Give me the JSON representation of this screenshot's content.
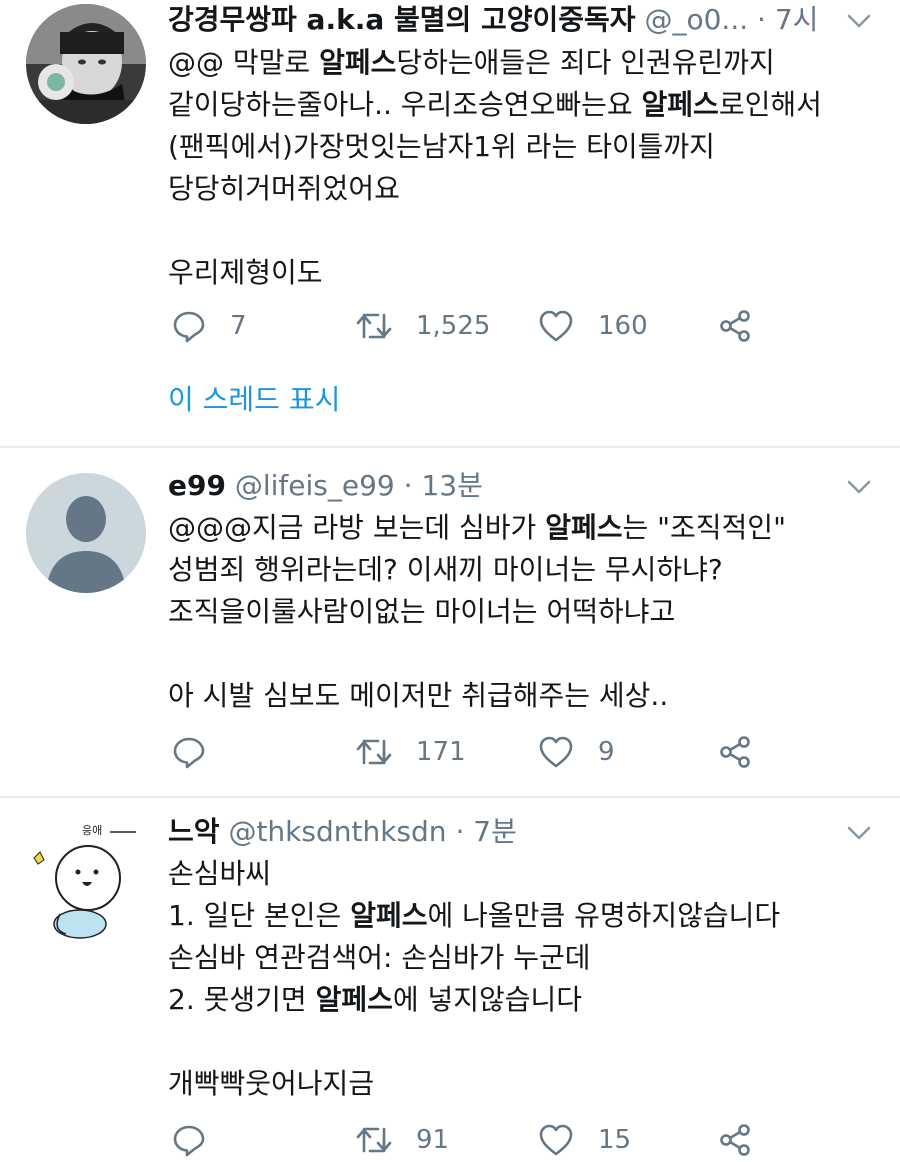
{
  "tweets": [
    {
      "name": "강경무쌍파 a.k.a 불멸의 고양이중독자",
      "handle": "@_o0...",
      "dot": "·",
      "time": "7시",
      "body": [
        "@@ 막말로 |알페스|당하는애들은 죄다 인권유린까지",
        "같이당하는줄아나.. 우리조승연오빠는요 |알페스|로인해서",
        "(팬픽에서)가장멋잇는남자1위 라는 타이틀까지",
        "당당히거머쥐었어요",
        "",
        "우리제형이도"
      ],
      "reply_count": "7",
      "retweet_count": "1,525",
      "like_count": "160",
      "show_thread": "이 스레드 표시"
    },
    {
      "name": "e99",
      "handle": "@lifeis_e99",
      "dot": "·",
      "time": "13분",
      "body": [
        "@@@지금 라방 보는데 심바가 |알페스|는 \"조직적인\"",
        "성범죄 행위라는데? 이새끼 마이너는 무시하냐?",
        "조직을이룰사람이없는 마이너는 어떡하냐고",
        "",
        "아 시발 심보도 메이저만 취급해주는 세상.."
      ],
      "reply_count": "",
      "retweet_count": "171",
      "like_count": "9"
    },
    {
      "name": "느악",
      "handle": "@thksdnthksdn",
      "dot": "·",
      "time": "7분",
      "body": [
        "손심바씨",
        "1. 일단 본인은 |알페스|에 나올만큼 유명하지않습니다",
        "손심바 연관검색어: 손심바가 누군데",
        "2. 못생기면 |알페스|에 넣지않습니다",
        "",
        "개빡빡웃어나지금"
      ],
      "reply_count": "",
      "retweet_count": "91",
      "like_count": "15",
      "avatar_text": "응애"
    }
  ],
  "colors": {
    "text": "#14171a",
    "secondary": "#657786",
    "link": "#1b95e0",
    "divider": "#e6ecf0"
  },
  "icons": {
    "reply": "reply-icon",
    "retweet": "retweet-icon",
    "like": "like-icon",
    "share": "share-icon",
    "caret": "chevron-down-icon"
  }
}
